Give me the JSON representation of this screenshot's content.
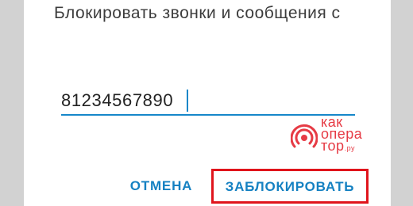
{
  "dialog": {
    "title": "Блокировать звонки и сообщения с",
    "input": {
      "value": "81234567890"
    },
    "buttons": {
      "cancel_label": "ОТМЕНА",
      "block_label": "ЗАБЛОКИРОВАТЬ"
    }
  },
  "watermark": {
    "line1": "как",
    "line2": "опера",
    "line3": "тор",
    "suffix": ".ру",
    "icon": "signal-waves-icon"
  },
  "colors": {
    "accent": "#1687c9",
    "button_text": "#1581c2",
    "highlight_frame": "#e0141c",
    "watermark": "#e63b45",
    "backdrop": "#d2d2d2"
  }
}
